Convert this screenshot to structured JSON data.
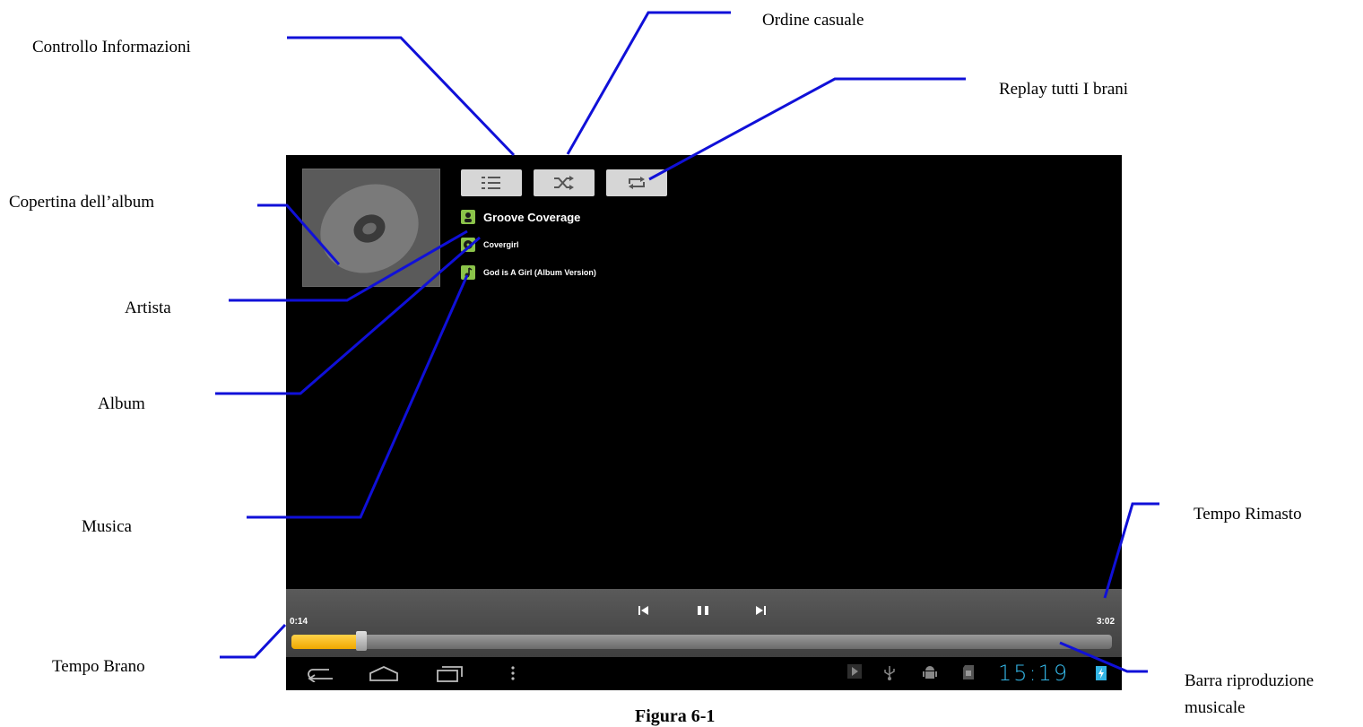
{
  "callouts": {
    "controllo_informazioni": "Controllo Informazioni",
    "ordine_casuale": "Ordine casuale",
    "replay": "Replay tutti I brani",
    "copertina": "Copertina dell’album",
    "artista": "Artista",
    "album": "Album",
    "musica": "Musica",
    "tempo_rimasto": "Tempo Rimasto",
    "tempo_brano": "Tempo Brano",
    "barra_line1": "Barra riproduzione",
    "barra_line2": "musicale"
  },
  "caption": "Figura 6-1",
  "player": {
    "artist": "Groove Coverage",
    "album": "Covergirl",
    "song": "God is A Girl (Album Version)",
    "elapsed": "0:14",
    "total": "3:02",
    "progress_percent": 8.5,
    "clock": "15:19",
    "top_buttons": [
      "list-icon",
      "shuffle-icon",
      "repeat-icon"
    ],
    "accent_color": "#f5b400",
    "clock_color": "#33b5e5",
    "info_icon_color": "#8bc34a"
  }
}
